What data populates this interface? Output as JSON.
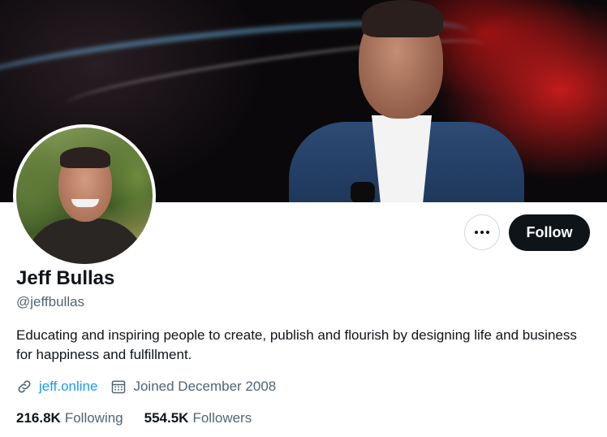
{
  "profile": {
    "name": "Jeff Bullas",
    "handle": "@jeffbullas",
    "bio": "Educating and inspiring people to create, publish and flourish by designing life and business for happiness and fulfillment.",
    "website": "jeff.online",
    "joined": "Joined December 2008"
  },
  "actions": {
    "follow_label": "Follow",
    "more_icon": "more-horizontal-icon"
  },
  "stats": {
    "following_count": "216.8K",
    "following_label": "Following",
    "followers_count": "554.5K",
    "followers_label": "Followers"
  },
  "colors": {
    "accent": "#1d9bf0",
    "text_primary": "#0f1419",
    "text_secondary": "#536471",
    "follow_button_bg": "#0f1419"
  }
}
